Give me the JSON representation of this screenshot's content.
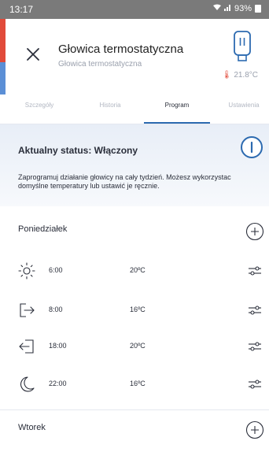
{
  "status_bar": {
    "time": "13:17",
    "battery": "93%"
  },
  "header": {
    "title": "Głowica termostatyczna",
    "subtitle": "Głowica termostatyczna",
    "current_temp": "21.8°C"
  },
  "tabs": [
    {
      "label": "Szczegóły"
    },
    {
      "label": "Historia"
    },
    {
      "label": "Program"
    },
    {
      "label": "Ustawienia"
    }
  ],
  "active_tab": "Program",
  "status": {
    "title": "Aktualny status: Włączony",
    "description": "Zaprogramuj działanie głowicy na cały tydzień. Możesz wykorzystac domyślne temperatury lub ustawić je ręcznie."
  },
  "days": [
    {
      "name": "Poniedziałek",
      "entries": [
        {
          "icon": "sun-icon",
          "time": "6:00",
          "temp": "20ºC"
        },
        {
          "icon": "leave-home-icon",
          "time": "8:00",
          "temp": "16ºC"
        },
        {
          "icon": "enter-home-icon",
          "time": "18:00",
          "temp": "20ºC"
        },
        {
          "icon": "moon-icon",
          "time": "22:00",
          "temp": "16ºC"
        }
      ]
    },
    {
      "name": "Wtorek",
      "entries": []
    }
  ],
  "colors": {
    "accent": "#2c6ab0",
    "red_strip": "#e14a3a",
    "blue_strip": "#5b8fd6"
  }
}
